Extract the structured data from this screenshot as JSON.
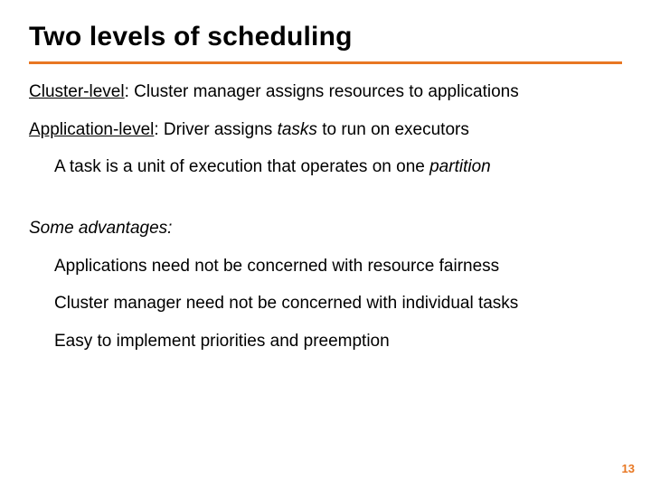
{
  "title": "Two levels of scheduling",
  "cluster": {
    "label": "Cluster-level",
    "text": ": Cluster manager assigns resources to applications"
  },
  "app": {
    "label": "Application-level",
    "text1": ": Driver assigns ",
    "em": "tasks",
    "text2": " to run on executors"
  },
  "task_line": {
    "t1": "A task is a unit of execution that operates on one ",
    "em": "partition"
  },
  "advantages": {
    "heading": "Some advantages:",
    "items": [
      "Applications need not be concerned with resource fairness",
      "Cluster manager need not be concerned with individual tasks",
      "Easy to implement priorities and preemption"
    ]
  },
  "page_number": "13"
}
